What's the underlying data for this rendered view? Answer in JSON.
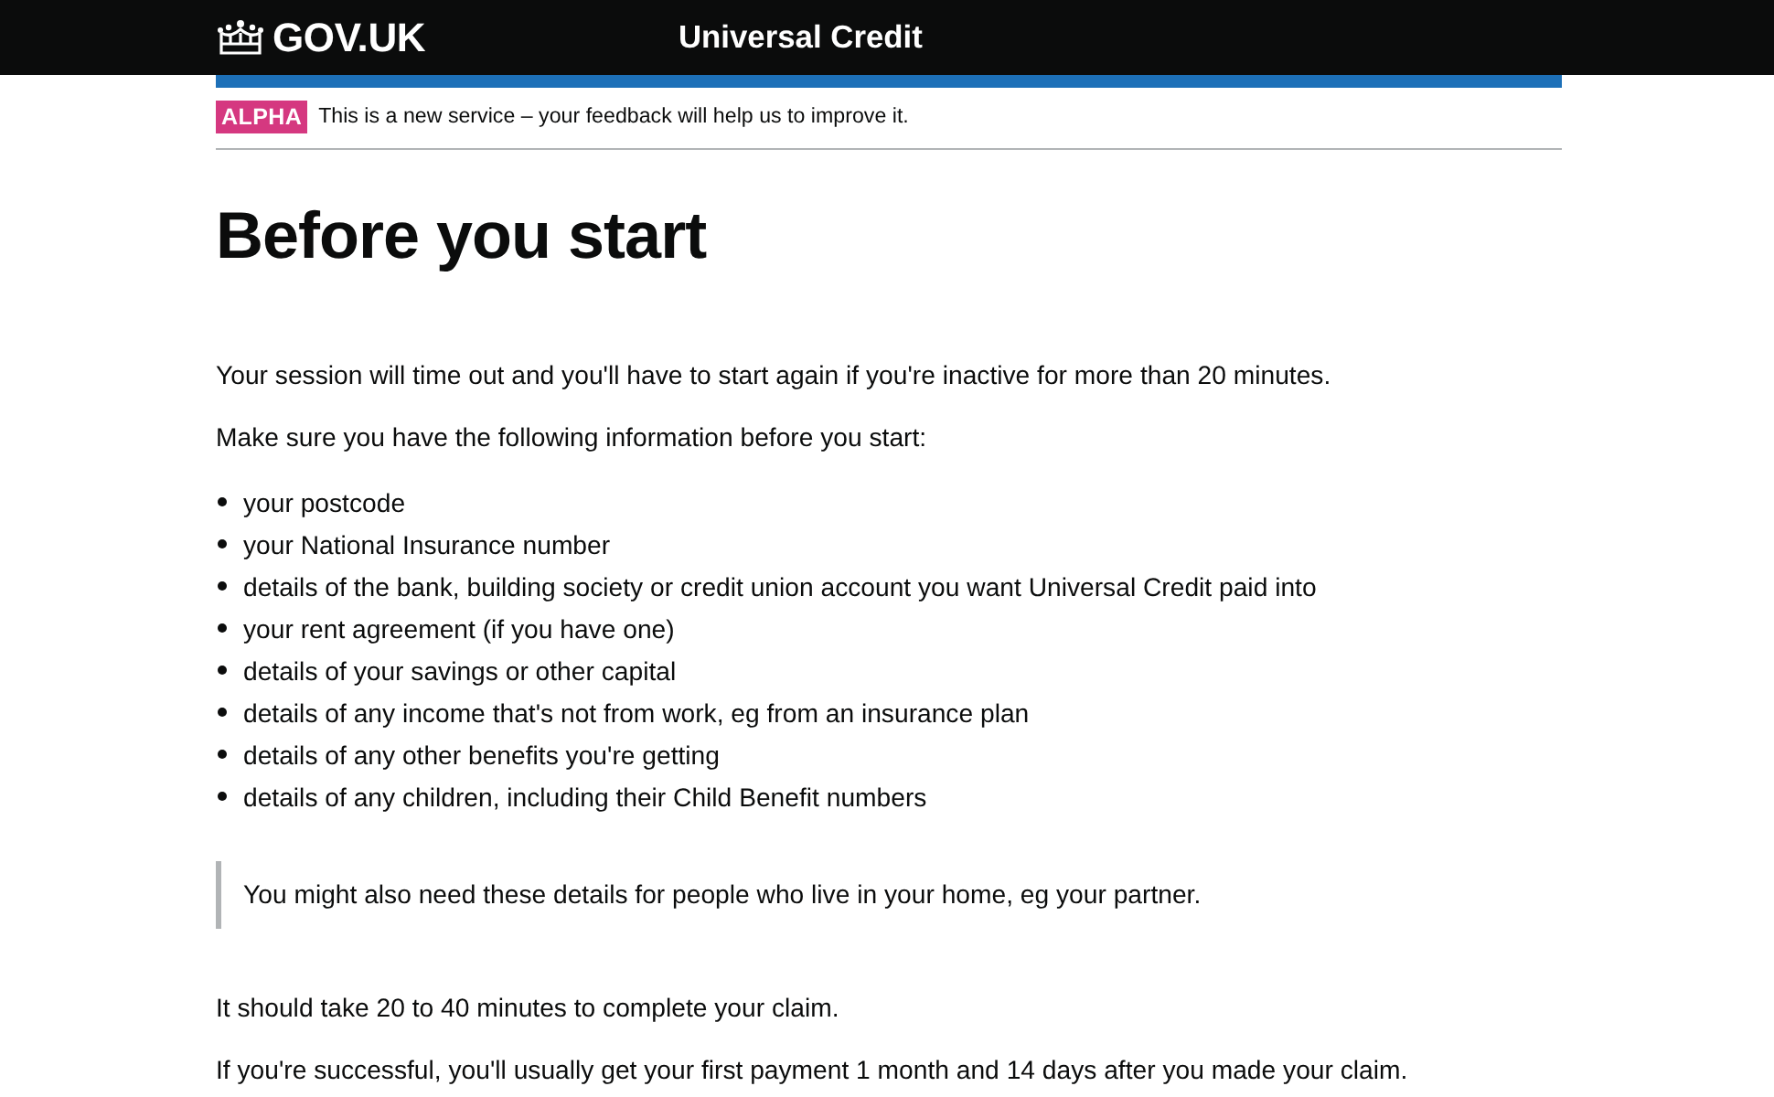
{
  "header": {
    "logo_text": "GOV.UK",
    "service_name": "Universal Credit"
  },
  "phase_banner": {
    "tag": "ALPHA",
    "text": "This is a new service – your feedback will help us to improve it."
  },
  "heading": "Before you start",
  "intro": [
    "Your session will time out and you'll have to start again if you're inactive for more than 20 minutes.",
    "Make sure you have the following information before you start:"
  ],
  "checklist": [
    "your postcode",
    "your National Insurance number",
    "details of the bank, building society or credit union account you want Universal Credit paid into",
    "your rent agreement (if you have one)",
    "details of your savings or other capital",
    "details of any income that's not from work, eg from an insurance plan",
    "details of any other benefits you're getting",
    "details of any children, including their Child Benefit numbers"
  ],
  "inset_text": "You might also need these details for people who live in your home, eg your partner.",
  "closing": [
    "It should take 20 to 40 minutes to complete your claim.",
    "If you're successful, you'll usually get your first payment 1 month and 14 days after you made your claim."
  ]
}
